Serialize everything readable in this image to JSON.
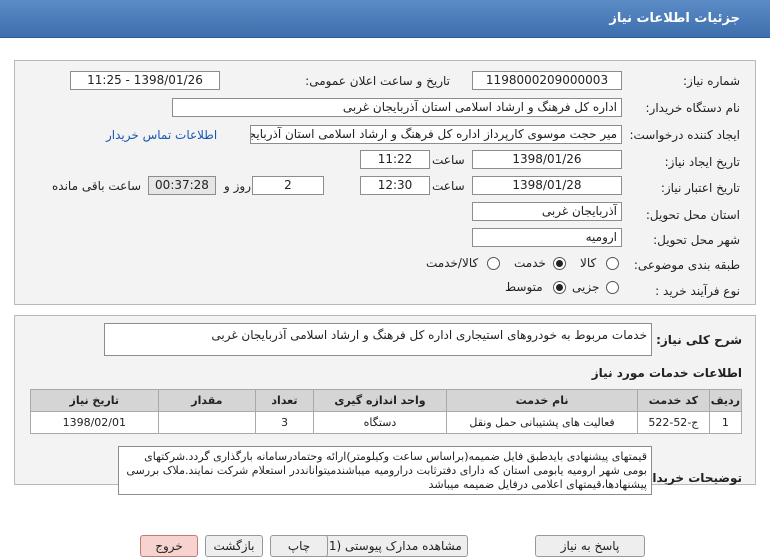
{
  "header": {
    "title": "جزئیات اطلاعات نیاز"
  },
  "form": {
    "need_number_label": "شماره نیاز:",
    "need_number": "1198000209000003",
    "announce_label": "تاریخ و ساعت اعلان عمومی:",
    "announce_value": "1398/01/26 - 11:25",
    "buyer_label": "نام دستگاه خریدار:",
    "buyer_value": "اداره کل فرهنگ و ارشاد اسلامی استان آذربایجان غربی",
    "requester_label": "ایجاد کننده درخواست:",
    "requester_value": "میر حجت موسوی کارپرداز اداره کل فرهنگ و ارشاد اسلامی استان آذربایجان غربی",
    "contact_link": "اطلاعات تماس خریدار",
    "create_date_label": "تاریخ ایجاد نیاز:",
    "create_date": "1398/01/26",
    "time_label": "ساعت",
    "create_time": "11:22",
    "validity_label": "تاریخ اعتبار نیاز:",
    "validity_date": "1398/01/28",
    "validity_time": "12:30",
    "days": "2",
    "day_and_label": "روز و",
    "remaining": "00:37:28",
    "remaining_label": "ساعت باقی مانده",
    "province_label": "استان محل تحویل:",
    "province": "آذربایجان غربی",
    "city_label": "شهر محل تحویل:",
    "city": "ارومیه",
    "category_label": "طبقه بندی موضوعی:",
    "category_options": [
      "کالا",
      "خدمت",
      "کالا/خدمت"
    ],
    "category_selected": "خدمت",
    "process_label": "نوع فرآیند خرید :",
    "process_options": [
      "جزیی",
      "متوسط"
    ],
    "process_selected": "متوسط"
  },
  "summary": {
    "label": "شرح کلی نیاز:",
    "value": "خدمات مربوط به خودروهای استیجاری اداره کل فرهنگ و ارشاد اسلامی آذربایجان غربی"
  },
  "services": {
    "title": "اطلاعات خدمات مورد نیاز",
    "columns": [
      "ردیف",
      "کد خدمت",
      "نام خدمت",
      "واحد اندازه گیری",
      "تعداد",
      "مقدار",
      "تاریخ نیاز"
    ],
    "rows": [
      [
        "1",
        "ج-52-522",
        "فعالیت های پشتیبانی حمل ونقل",
        "دستگاه",
        "3",
        "",
        "1398/02/01"
      ]
    ]
  },
  "notes": {
    "label": "توضیحات خریدار:",
    "value": "قیمتهای پیشنهادی بایدطبق فایل ضمیمه(براساس ساعت وکیلومتر)ارائه وحتمادرسامانه بارگذاری گردد.شرکتهای بومی شهر ارومیه یابومی استان که دارای دفترثابت درارومیه میباشندمیتوانانددر استعلام شرکت نمایند.ملاک بررسی پیشنهادها،قیمتهای اعلامی درفایل ضمیمه میباشد"
  },
  "buttons": {
    "reply": "پاسخ به نیاز",
    "attachments": "مشاهده مدارک پیوستی (1)",
    "print": "چاپ",
    "back": "بازگشت",
    "exit": "خروج"
  }
}
